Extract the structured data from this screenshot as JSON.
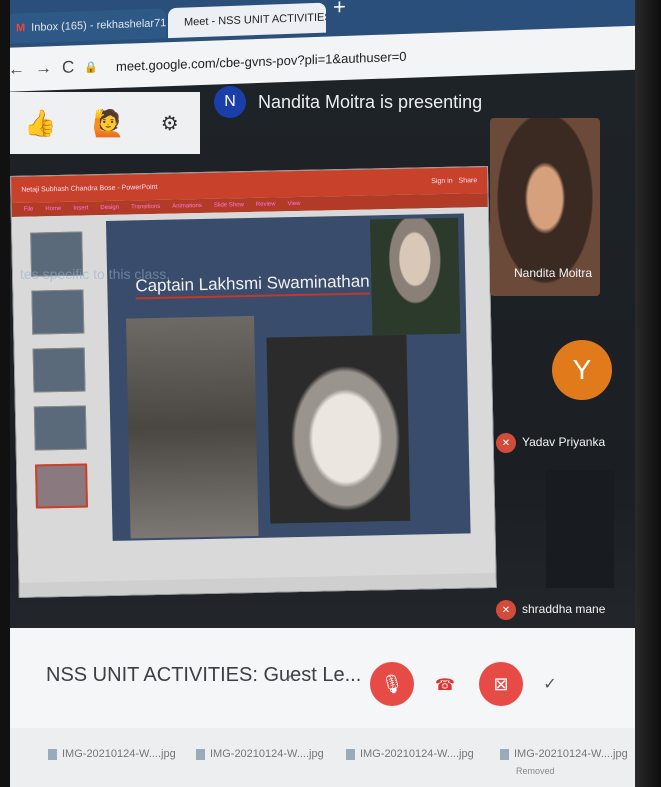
{
  "browser": {
    "tabs": [
      {
        "label": "Inbox (165) - rekhashelar71@gm",
        "close": "×"
      },
      {
        "label": "Meet - NSS UNIT ACTIVITIES",
        "close": "×"
      }
    ],
    "new_tab": "+",
    "url": "meet.google.com/cbe-gvns-pov?pli=1&authuser=0",
    "nav": {
      "back": "←",
      "forward": "→",
      "reload": "C"
    }
  },
  "reactions": {
    "thumbs": "👍",
    "person": "🙋",
    "settings": "⚙"
  },
  "presenter": {
    "initial": "N",
    "banner": "Nandita Moitra is presenting"
  },
  "slide": {
    "title": "Captain Lakhsmi Swaminathan",
    "ppt_title": "Netaji Subhash Chandra Bose - PowerPoint",
    "ppt_signin": "Sign in",
    "ppt_share": "Share",
    "ribbon": [
      "File",
      "Home",
      "Insert",
      "Design",
      "Transitions",
      "Animations",
      "Slide Show",
      "Review",
      "View"
    ],
    "ghost_text": [
      "tes specific to this class."
    ]
  },
  "participants": [
    {
      "name": "Nandita Moitra"
    },
    {
      "name": "Yadav Priyanka",
      "initial": "Y",
      "muted": true,
      "color": "#e07a1a"
    },
    {
      "name": "shraddha mane",
      "muted": true
    }
  ],
  "meeting": {
    "title": "NSS UNIT ACTIVITIES: Guest Le...",
    "chevron": "^"
  },
  "controls": {
    "mic": "mic-off",
    "end": "end-call",
    "camera": "camera-off",
    "more": "✓"
  },
  "downloads": [
    {
      "name": "IMG-20210124-W....jpg"
    },
    {
      "name": "IMG-20210124-W....jpg"
    },
    {
      "name": "IMG-20210124-W....jpg"
    },
    {
      "name": "IMG-20210124-W....jpg",
      "sub": "Removed"
    }
  ],
  "colors": {
    "tabbar": "#2a4f7a",
    "accent_red": "#e64b46",
    "avatar_blue": "#1a3fa8",
    "avatar_orange": "#e07a1a"
  }
}
